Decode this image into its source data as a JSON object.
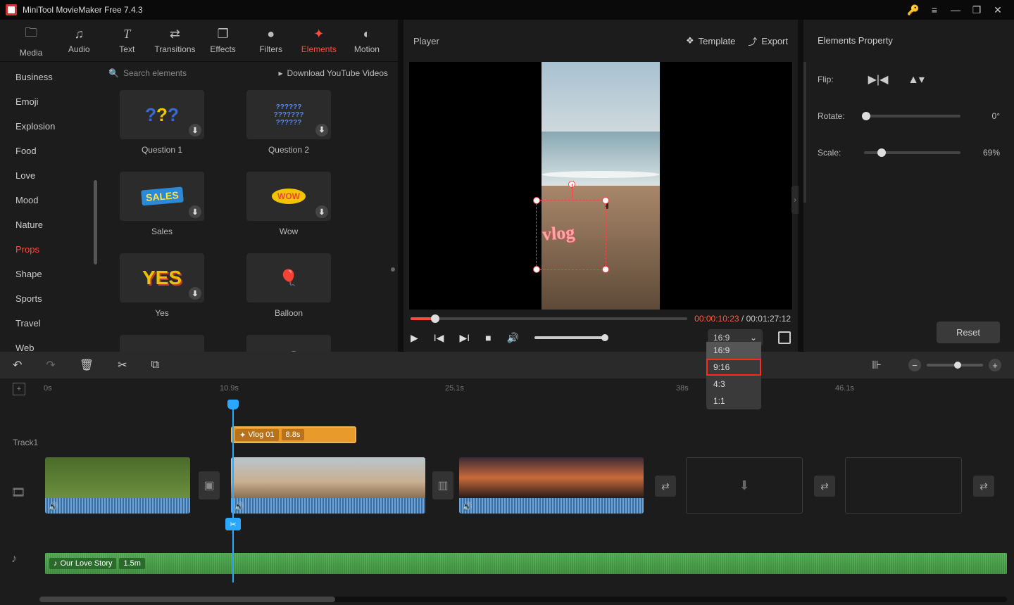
{
  "app": {
    "title": "MiniTool MovieMaker Free 7.4.3"
  },
  "toolbar": {
    "items": [
      {
        "label": "Media",
        "icon": "🗀"
      },
      {
        "label": "Audio",
        "icon": "♫"
      },
      {
        "label": "Text",
        "icon": "T"
      },
      {
        "label": "Transitions",
        "icon": "⇄"
      },
      {
        "label": "Effects",
        "icon": "❐"
      },
      {
        "label": "Filters",
        "icon": "●"
      },
      {
        "label": "Elements",
        "icon": "✦",
        "active": true
      },
      {
        "label": "Motion",
        "icon": "◐"
      }
    ]
  },
  "categories": [
    "Business",
    "Emoji",
    "Explosion",
    "Food",
    "Love",
    "Mood",
    "Nature",
    "Props",
    "Shape",
    "Sports",
    "Travel",
    "Web"
  ],
  "active_category": "Props",
  "search": {
    "placeholder": "Search elements",
    "yt": "Download YouTube Videos"
  },
  "elements": [
    {
      "name": "Question 1"
    },
    {
      "name": "Question 2"
    },
    {
      "name": "Sales"
    },
    {
      "name": "Wow"
    },
    {
      "name": "Yes"
    },
    {
      "name": "Balloon"
    }
  ],
  "player": {
    "title": "Player",
    "template": "Template",
    "export": "Export",
    "current": "00:00:10:23",
    "total": "00:01:27:12",
    "aspect_selected": "16:9",
    "aspect_options": [
      "16:9",
      "9:16",
      "4:3",
      "1:1"
    ],
    "aspect_highlight": "9:16",
    "overlay_text": "vlog"
  },
  "properties": {
    "title": "Elements Property",
    "flip_label": "Flip:",
    "rotate_label": "Rotate:",
    "rotate_value": "0°",
    "scale_label": "Scale:",
    "scale_value": "69%",
    "reset": "Reset"
  },
  "ruler": {
    "marks": [
      "0s",
      "10.9s",
      "25.1s",
      "38s",
      "46.1s"
    ]
  },
  "timeline": {
    "track1_label": "Track1",
    "element_clip": {
      "name": "Vlog 01",
      "duration": "8.8s"
    },
    "audio": {
      "name": "Our Love Story",
      "duration": "1.5m"
    }
  }
}
